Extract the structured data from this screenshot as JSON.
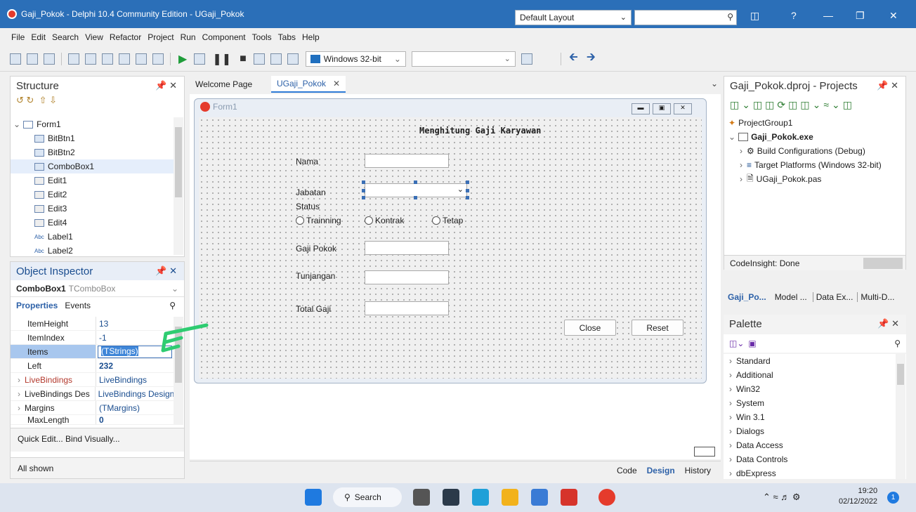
{
  "window": {
    "title": "Gaji_Pokok - Delphi 10.4 Community Edition - UGaji_Pokok",
    "layout_label": "Default Layout",
    "help_label": "?"
  },
  "menu": [
    "File",
    "Edit",
    "Search",
    "View",
    "Refactor",
    "Project",
    "Run",
    "Component",
    "Tools",
    "Tabs",
    "Help"
  ],
  "toolbar": {
    "platform": "Windows 32-bit"
  },
  "structure": {
    "title": "Structure",
    "pin": "↕ ✕",
    "items": [
      {
        "label": "Form1"
      },
      {
        "label": "BitBtn1"
      },
      {
        "label": "BitBtn2"
      },
      {
        "label": "ComboBox1"
      },
      {
        "label": "Edit1"
      },
      {
        "label": "Edit2"
      },
      {
        "label": "Edit3"
      },
      {
        "label": "Edit4"
      },
      {
        "label": "Label1"
      },
      {
        "label": "Label2"
      }
    ]
  },
  "object_inspector": {
    "title": "Object Inspector",
    "selected_component": "ComboBox1",
    "selected_type": "TComboBox",
    "tab_properties": "Properties",
    "tab_events": "Events",
    "rows": [
      {
        "name": "ItemHeight",
        "value": "13"
      },
      {
        "name": "ItemIndex",
        "value": "-1"
      },
      {
        "name": "Items",
        "value": "(TStrings)"
      },
      {
        "name": "Left",
        "value": "232"
      },
      {
        "name": "LiveBindings",
        "value": "LiveBindings"
      },
      {
        "name": "LiveBindings Des",
        "value": "LiveBindings Design"
      },
      {
        "name": "Margins",
        "value": "(TMargins)"
      },
      {
        "name": "MaxLength",
        "value": "0"
      }
    ],
    "footer_links": "Quick Edit... Bind Visually...",
    "status": "All shown"
  },
  "editor": {
    "tabs": [
      "Welcome Page",
      "UGaji_Pokok"
    ],
    "bottom_tabs": [
      "Code",
      "Design",
      "History"
    ]
  },
  "form": {
    "caption": "Form1",
    "heading": "Menghitung Gaji Karyawan",
    "label_nama": "Nama",
    "label_jabatan": "Jabatan",
    "label_status": "Status",
    "radio_trainning": "Trainning",
    "radio_kontrak": "Kontrak",
    "radio_tetap": "Tetap",
    "label_gaji_pokok": "Gaji Pokok",
    "label_tunjangan": "Tunjangan",
    "label_total_gaji": "Total Gaji",
    "btn_close": "Close",
    "btn_reset": "Reset"
  },
  "projects": {
    "title": "Gaji_Pokok.dproj - Projects",
    "items": [
      {
        "label": "ProjectGroup1"
      },
      {
        "label": "Gaji_Pokok.exe"
      },
      {
        "label": "Build Configurations (Debug)"
      },
      {
        "label": "Target Platforms (Windows 32-bit)"
      },
      {
        "label": "UGaji_Pokok.pas"
      }
    ],
    "codeinsight": "CodeInsight: Done",
    "bottom_tabs": [
      "Gaji_Po...",
      "Model ...",
      "Data Ex...",
      "Multi-D..."
    ]
  },
  "palette": {
    "title": "Palette",
    "items": [
      "Standard",
      "Additional",
      "Win32",
      "System",
      "Win 3.1",
      "Dialogs",
      "Data Access",
      "Data Controls",
      "dbExpress"
    ]
  },
  "taskbar": {
    "search": "Search",
    "time": "19:20",
    "date": "02/12/2022",
    "notif_count": "1"
  },
  "colors": {
    "titlebar": "#2b6fb8",
    "accent": "#2d7ad6",
    "annotation": "#2ecc71"
  }
}
